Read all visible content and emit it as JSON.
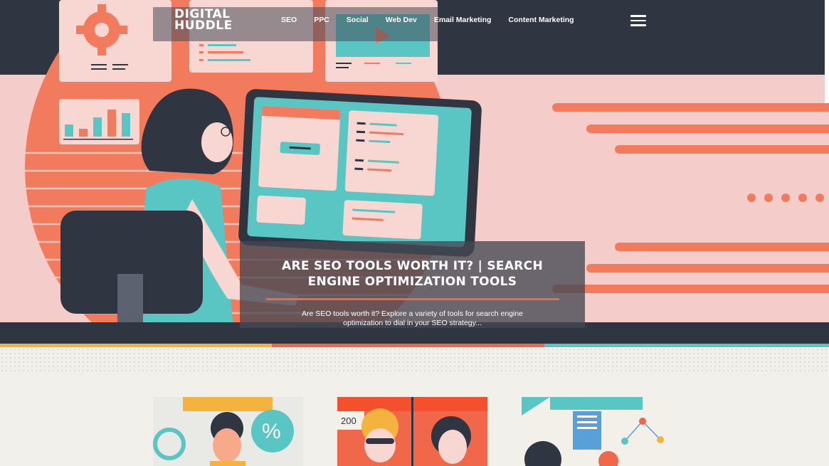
{
  "header": {
    "logo_line1": "DIGITAL",
    "logo_line2": "HUDDLE",
    "nav": [
      "SEO",
      "PPC",
      "Social",
      "Web Dev",
      "Email Marketing",
      "Content Marketing"
    ],
    "menu_icon": "hamburger-menu-icon"
  },
  "hero": {
    "title": "Are SEO Tools Worth It? | Search Engine Optimization Tools",
    "excerpt": "Are SEO tools worth it? Explore a variety of tools for search engine optimization to dial in your SEO strategy...",
    "accent_color": "#f0674a"
  },
  "posts": [
    {
      "badge": "",
      "image": "person-with-percent-illustration"
    },
    {
      "badge": "200",
      "image": "two-people-illustration"
    },
    {
      "badge": "",
      "image": "chart-network-illustration"
    }
  ],
  "colors": {
    "navy": "#2f3642",
    "coral": "#f0674a",
    "teal": "#5ac6c4",
    "pink": "#f4cdcb",
    "yellow": "#f4b23e"
  }
}
